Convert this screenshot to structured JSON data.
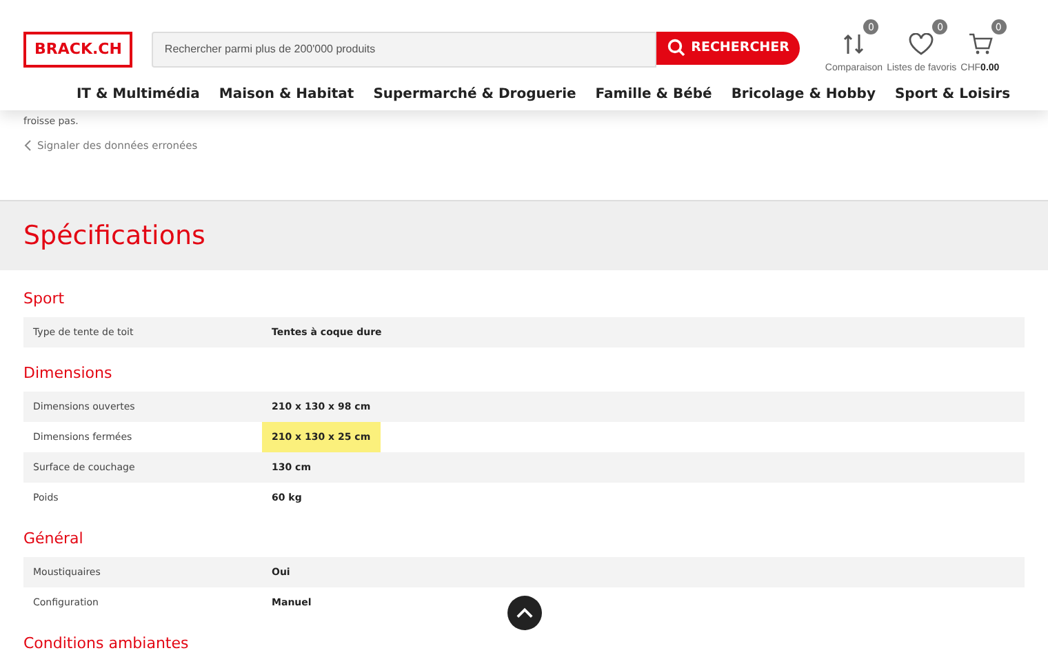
{
  "header": {
    "logo": "BRACK.CH",
    "search": {
      "placeholder": "Rechercher parmi plus de 200'000 produits",
      "button": "RECHERCHER"
    },
    "actions": [
      {
        "kind": "compare",
        "label": "Comparaison",
        "count": "0"
      },
      {
        "kind": "favorites",
        "label": "Listes de favoris",
        "count": "0"
      },
      {
        "kind": "cart",
        "label": "CHF",
        "amount": "0.00",
        "count": "0"
      }
    ],
    "nav": [
      "IT & Multimédia",
      "Maison & Habitat",
      "Supermarché & Droguerie",
      "Famille & Bébé",
      "Bricolage & Hobby",
      "Sport & Loisirs"
    ]
  },
  "description_tail": "froisse pas.",
  "report_link": "Signaler des données erronées",
  "specifications": {
    "title": "Spécifications",
    "groups": [
      {
        "title": "Sport",
        "rows": [
          {
            "label": "Type de tente de toit",
            "value": "Tentes à coque dure",
            "highlighted": false
          }
        ]
      },
      {
        "title": "Dimensions",
        "rows": [
          {
            "label": "Dimensions ouvertes",
            "value": "210 x 130 x 98 cm",
            "highlighted": false
          },
          {
            "label": "Dimensions fermées",
            "value": "210 x 130 x 25 cm",
            "highlighted": true
          },
          {
            "label": "Surface de couchage",
            "value": "130 cm",
            "highlighted": false
          },
          {
            "label": "Poids",
            "value": "60 kg",
            "highlighted": false
          }
        ]
      },
      {
        "title": "Général",
        "rows": [
          {
            "label": "Moustiquaires",
            "value": "Oui",
            "highlighted": false
          },
          {
            "label": "Configuration",
            "value": "Manuel",
            "highlighted": false
          }
        ]
      },
      {
        "title": "Conditions ambiantes"
      }
    ]
  }
}
